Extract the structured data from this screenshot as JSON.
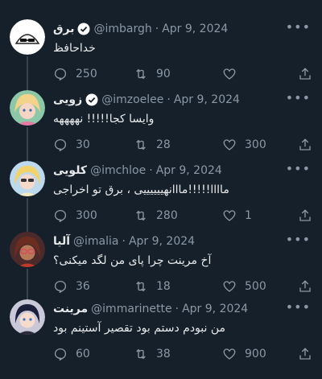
{
  "tweets": [
    {
      "name": "برق",
      "verified": true,
      "handle": "@imbargh",
      "date": "Apr 9, 2024",
      "text": "خداحافظ",
      "replies": "250",
      "retweets": "90",
      "likes": ""
    },
    {
      "name": "زویی",
      "verified": true,
      "handle": "@imzoelee",
      "date": "Apr 9, 2024",
      "text": "وایسا کجا!!!!! نههههه",
      "replies": "30",
      "retweets": "28",
      "likes": "300"
    },
    {
      "name": "کلویی",
      "verified": false,
      "handle": "@imchloe",
      "date": "Apr 9, 2024",
      "text": "ماااا!!!!!مااانهییییییی ، برق تو اخراجی",
      "replies": "300",
      "retweets": "280",
      "likes": "1"
    },
    {
      "name": "آلیا",
      "verified": false,
      "handle": "@imalia",
      "date": "Apr 9, 2024",
      "text": "آخ مرینت چرا پای من لگد میکنی؟",
      "replies": "36",
      "retweets": "18",
      "likes": "500"
    },
    {
      "name": "مرینت",
      "verified": false,
      "handle": "@immarinette",
      "date": "Apr 9, 2024",
      "text": "من نبودم دستم بود تقصیر آستینم بود",
      "replies": "60",
      "retweets": "38",
      "likes": "900"
    }
  ],
  "icons": {
    "reply": "reply-icon",
    "retweet": "retweet-icon",
    "like": "heart-icon",
    "share": "share-icon",
    "more": "more-icon",
    "verified": "verified-badge-icon"
  },
  "colors": {
    "background": "#15202b",
    "text": "#e7e9ea",
    "muted": "#8b98a5",
    "thread_line": "#38444d"
  }
}
